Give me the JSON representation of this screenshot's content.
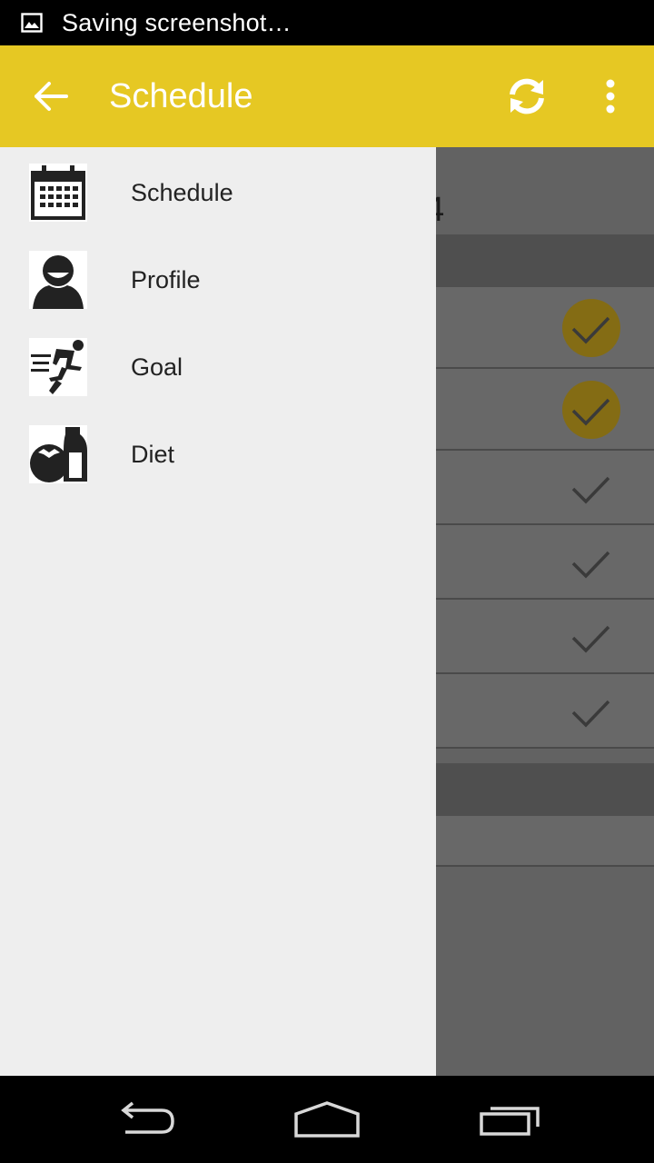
{
  "status_bar": {
    "text": "Saving screenshot…",
    "icon": "image-icon"
  },
  "app_bar": {
    "title": "Schedule",
    "color": "#e6c823",
    "back_icon": "arrow-back-icon",
    "sync_icon": "sync-icon",
    "overflow_icon": "more-vert-icon"
  },
  "drawer": {
    "items": [
      {
        "label": "Schedule",
        "icon": "calendar-icon"
      },
      {
        "label": "Profile",
        "icon": "person-icon"
      },
      {
        "label": "Goal",
        "icon": "runner-icon"
      },
      {
        "label": "Diet",
        "icon": "tomato-bottle-icon"
      }
    ]
  },
  "background": {
    "partial_text": "4"
  },
  "nav_bar": {
    "back_icon": "nav-back-icon",
    "home_icon": "nav-home-icon",
    "recents_icon": "nav-recents-icon"
  }
}
